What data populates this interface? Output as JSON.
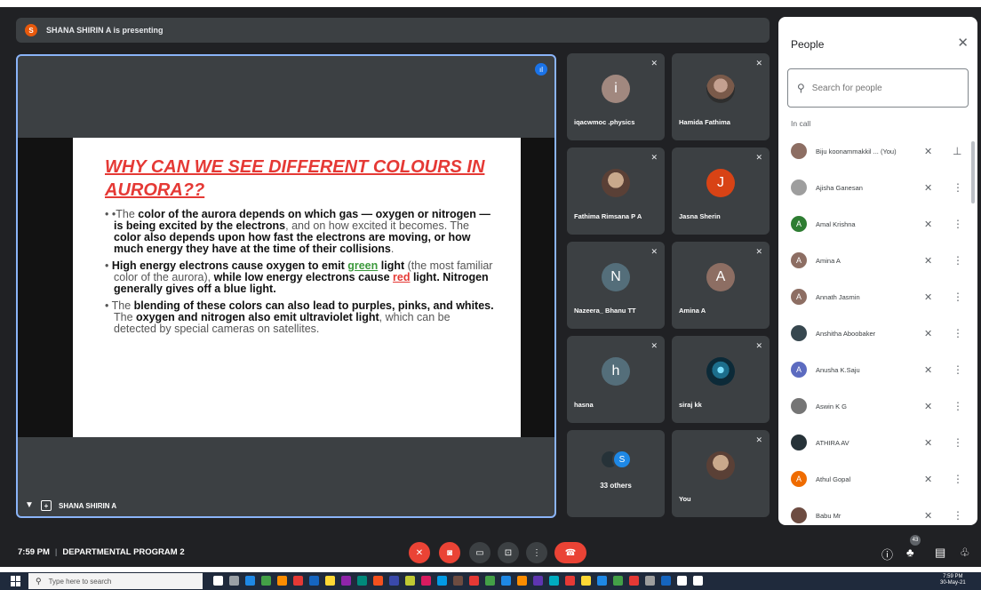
{
  "banner": {
    "initial": "S",
    "text": "SHANA SHIRIN A is presenting"
  },
  "slide": {
    "title": "WHY CAN WE SEE DIFFERENT COLOURS IN AURORA??",
    "b1": {
      "lead": "•The ",
      "p1": "color of the aurora depends on which gas — oxygen or nitrogen — is being excited by the electrons",
      "p2": ", and on how excited it becomes. The ",
      "p3": "color also depends upon how fast the electrons are moving, or how much energy they have at the time of their collisions",
      "p4": "."
    },
    "b2": {
      "p1": "High energy electrons cause oxygen to emit ",
      "green": "green",
      "p2": "light",
      "p3": " (the most familiar color of the aurora), ",
      "p4": "while low energy electrons cause ",
      "red": "red",
      "p5": " light. Nitrogen generally gives off a blue light."
    },
    "b3": {
      "p1": "The ",
      "p2": "blending of these colors can also lead to purples, pinks, and whites.",
      "p3": " The ",
      "p4": "oxygen and nitrogen also emit ultraviolet light",
      "p5": ", which can be detected by special cameras on satellites."
    }
  },
  "stage": {
    "presenter_name": "SHANA SHIRIN A"
  },
  "tiles": [
    {
      "name": "iqacwmoc .physics",
      "initial": "i",
      "color": "#a1887f"
    },
    {
      "name": "Hamida Fathima",
      "initial": "",
      "color": ""
    },
    {
      "name": "Fathima Rimsana P A",
      "initial": "",
      "color": ""
    },
    {
      "name": "Jasna Sherin",
      "initial": "J",
      "color": "#d84315"
    },
    {
      "name": "Nazeera_ Bhanu TT",
      "initial": "N",
      "color": "#546e7a"
    },
    {
      "name": "Amina A",
      "initial": "A",
      "color": "#8d6e63"
    },
    {
      "name": "hasna",
      "initial": "h",
      "color": "#546e7a"
    },
    {
      "name": "siraj kk",
      "initial": "",
      "color": ""
    },
    {
      "name": "33 others",
      "initial": "S",
      "color": "#1e88e5"
    },
    {
      "name": "You",
      "initial": "",
      "color": ""
    }
  ],
  "people": {
    "title": "People",
    "search_placeholder": "Search for people",
    "section": "In call",
    "list": [
      {
        "name": "Biju koonammakkil ... (You)",
        "initial": "",
        "color": "#8d6e63"
      },
      {
        "name": "Ajisha Ganesan",
        "initial": "",
        "color": "#9e9e9e"
      },
      {
        "name": "Amal Krishna",
        "initial": "A",
        "color": "#2e7d32"
      },
      {
        "name": "Amina A",
        "initial": "A",
        "color": "#8d6e63"
      },
      {
        "name": "Annath Jasmin",
        "initial": "A",
        "color": "#8d6e63"
      },
      {
        "name": "Anshitha Aboobaker",
        "initial": "",
        "color": "#37474f"
      },
      {
        "name": "Anusha K.Saju",
        "initial": "A",
        "color": "#5c6bc0"
      },
      {
        "name": "Aswin K G",
        "initial": "",
        "color": "#757575"
      },
      {
        "name": "ATHIRA AV",
        "initial": "",
        "color": "#263238"
      },
      {
        "name": "Athul Gopal",
        "initial": "A",
        "color": "#ef6c00"
      },
      {
        "name": "Babu Mr",
        "initial": "",
        "color": "#6d4c41"
      }
    ]
  },
  "bottom": {
    "time": "7:59 PM",
    "separator": "|",
    "meeting": "DEPARTMENTAL PROGRAM 2",
    "participants_badge": "43"
  },
  "taskbar": {
    "search_placeholder": "Type here to search",
    "clock_time": "7:59 PM",
    "clock_date": "30-May-21"
  }
}
